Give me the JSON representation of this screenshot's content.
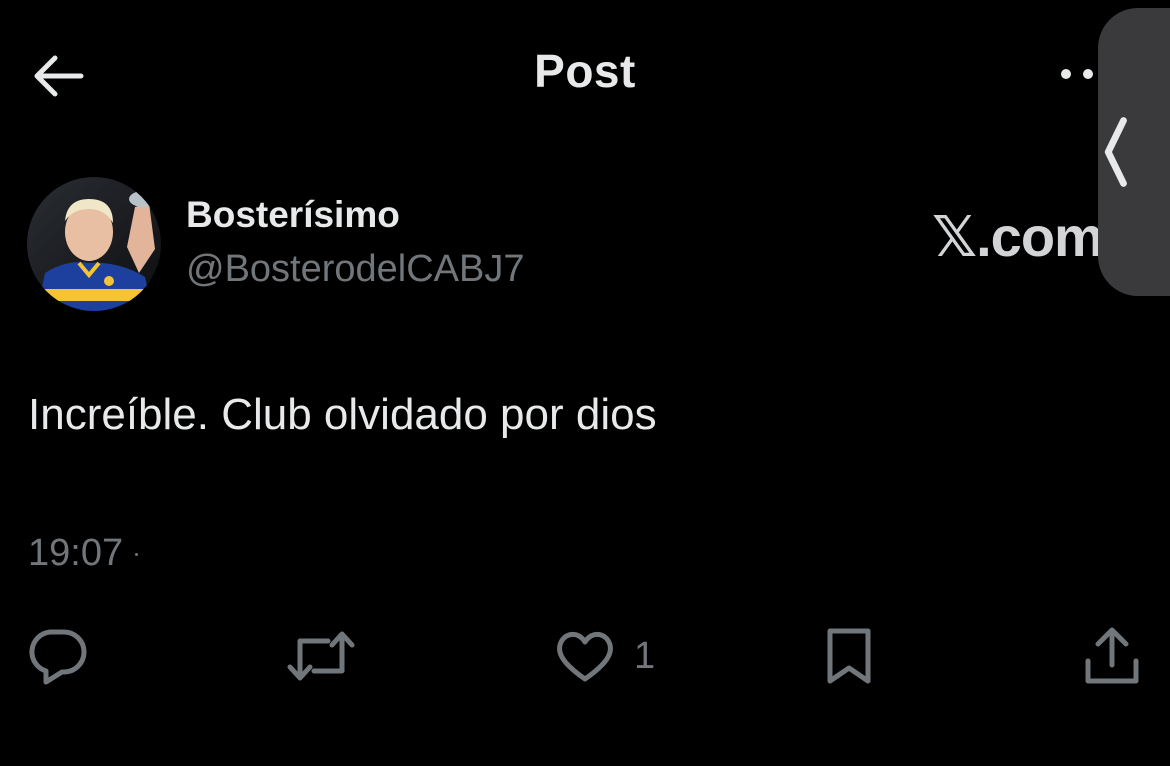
{
  "header": {
    "title": "Post",
    "back_icon": "arrow-left-icon",
    "more_icon": "more-horizontal-icon"
  },
  "side_tab": {
    "icon": "chevron-left-icon",
    "color": "#3a3a3c"
  },
  "author": {
    "display_name": "Bosterísimo",
    "handle": "@BosterodelCABJ7"
  },
  "watermark": "𝕏.com",
  "tweet": {
    "text": "Increíble. Club olvidado por dios",
    "time": "19:07"
  },
  "actions": {
    "reply": {
      "icon": "reply-icon"
    },
    "repost": {
      "icon": "repost-icon"
    },
    "like": {
      "icon": "heart-icon",
      "count": "1"
    },
    "bookmark": {
      "icon": "bookmark-icon"
    },
    "share": {
      "icon": "share-icon"
    }
  },
  "colors": {
    "background": "#000000",
    "text_primary": "#e7e9ea",
    "text_secondary": "#71767b"
  }
}
